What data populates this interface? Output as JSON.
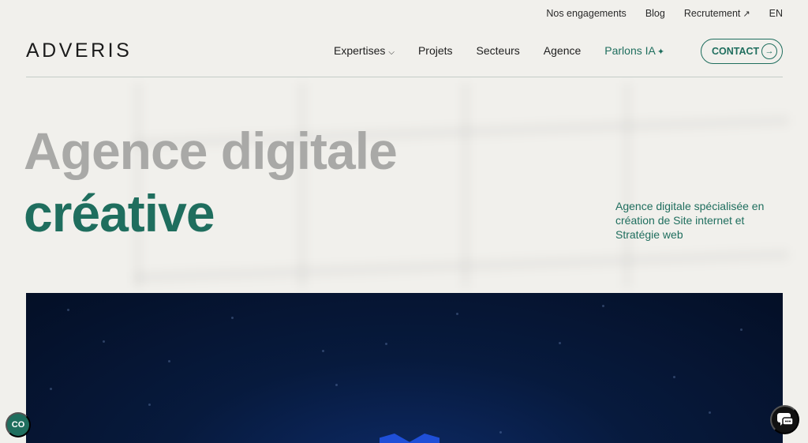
{
  "colors": {
    "background": "#f1f0ec",
    "accent": "#1f6e5e",
    "heading_gray": "#a9a9a7",
    "media_dark": "#071a3d"
  },
  "topbar": {
    "items": [
      {
        "label": "Nos engagements"
      },
      {
        "label": "Blog"
      },
      {
        "label": "Recrutement",
        "icon": "external-arrow-icon",
        "glyph": "↗"
      },
      {
        "label": "EN"
      }
    ]
  },
  "logo": {
    "text": "ADVERIS"
  },
  "nav": {
    "items": [
      {
        "label": "Expertises",
        "icon": "chevron-down-icon",
        "glyph": "⌵"
      },
      {
        "label": "Projets"
      },
      {
        "label": "Secteurs"
      },
      {
        "label": "Agence"
      },
      {
        "label": "Parlons IA",
        "icon": "sparkle-icon",
        "glyph": "✦"
      }
    ],
    "contact": {
      "label": "CONTACT",
      "icon": "arrow-right-icon",
      "glyph": "→"
    }
  },
  "hero": {
    "line1": "Agence digitale",
    "line2": "créative",
    "description": "Agence digitale spécialisée en création de Site internet et Stratégie web"
  },
  "widgets": {
    "cookie": {
      "label": "CO",
      "icon": "cookie-consent-icon"
    },
    "chat": {
      "icon": "chat-bubble-icon"
    }
  }
}
